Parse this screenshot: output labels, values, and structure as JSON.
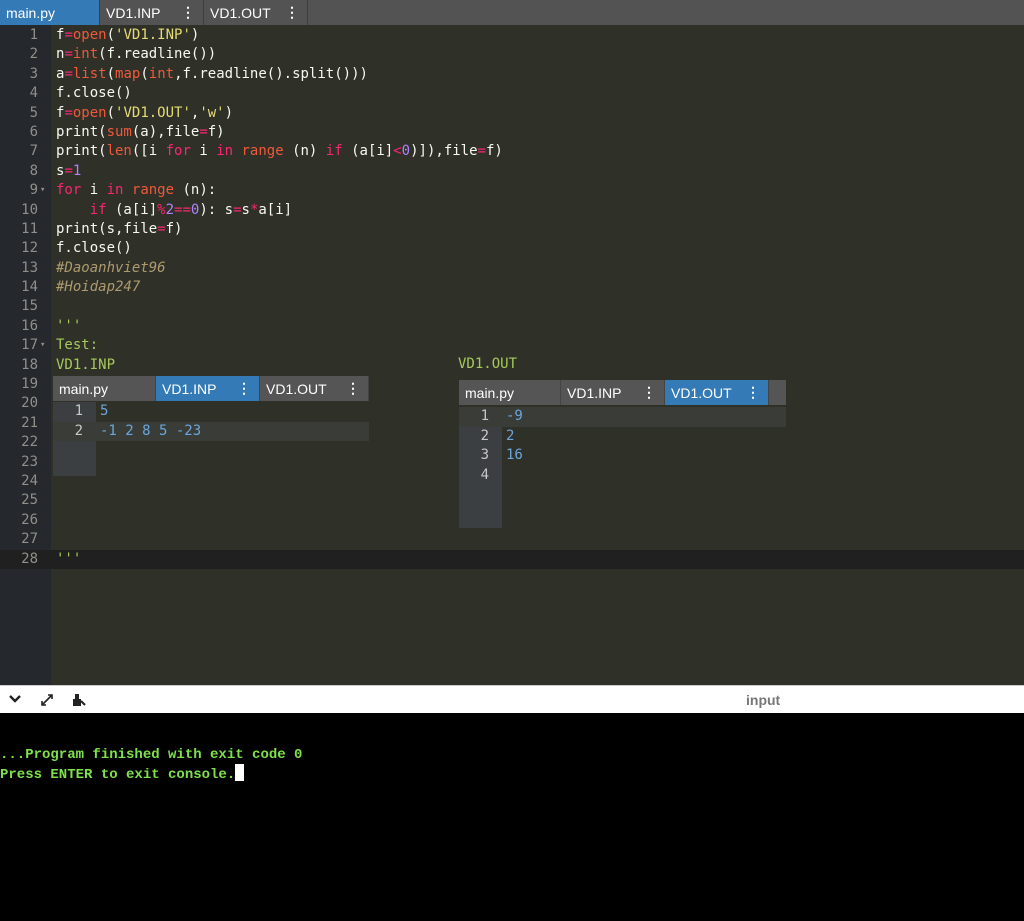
{
  "tabs": [
    {
      "label": "main.py",
      "active": true,
      "menu": false
    },
    {
      "label": "VD1.INP",
      "active": false,
      "menu": true
    },
    {
      "label": "VD1.OUT",
      "active": false,
      "menu": true
    }
  ],
  "editor": {
    "line_numbers": [
      "1",
      "2",
      "3",
      "4",
      "5",
      "6",
      "7",
      "8",
      "9",
      "10",
      "11",
      "12",
      "13",
      "14",
      "15",
      "16",
      "17",
      "18",
      "19",
      "20",
      "21",
      "22",
      "23",
      "24",
      "25",
      "26",
      "27",
      "28"
    ],
    "code": [
      "f=open('VD1.INP')",
      "n=int(f.readline())",
      "a=list(map(int,f.readline().split()))",
      "f.close()",
      "f=open('VD1.OUT','w')",
      "print(sum(a),file=f)",
      "print(len([i for i in range (n) if (a[i]<0)]),file=f)",
      "s=1",
      "for i in range (n):",
      "    if (a[i]%2==0): s=s*a[i]",
      "print(s,file=f)",
      "f.close()",
      "#Daoanhviet96",
      "#Hoidap247",
      "",
      "'''",
      "Test:",
      "VD1.INP",
      "",
      "",
      "",
      "",
      "",
      "",
      "",
      "",
      "",
      "'''"
    ],
    "out_label": "VD1.OUT"
  },
  "panel_inp": {
    "tabs": [
      {
        "label": "main.py",
        "active": false,
        "menu": false
      },
      {
        "label": "VD1.INP",
        "active": true,
        "menu": true
      },
      {
        "label": "VD1.OUT",
        "active": false,
        "menu": true
      }
    ],
    "line_numbers": [
      "1",
      "2"
    ],
    "lines": [
      "5",
      "-1 2 8 5 -23"
    ]
  },
  "panel_out": {
    "tabs": [
      {
        "label": "main.py",
        "active": false,
        "menu": false
      },
      {
        "label": "VD1.INP",
        "active": false,
        "menu": true
      },
      {
        "label": "VD1.OUT",
        "active": true,
        "menu": true
      }
    ],
    "line_numbers": [
      "1",
      "2",
      "3",
      "4"
    ],
    "lines": [
      "-9",
      "2",
      "16",
      ""
    ]
  },
  "console_toolbar": {
    "collapse_icon": "chevron-down-icon",
    "expand_icon": "expand-arrows-icon",
    "clear_icon": "clear-console-icon",
    "input_label": "input"
  },
  "console": {
    "line1": "...Program finished with exit code 0",
    "line2": "Press ENTER to exit console."
  }
}
